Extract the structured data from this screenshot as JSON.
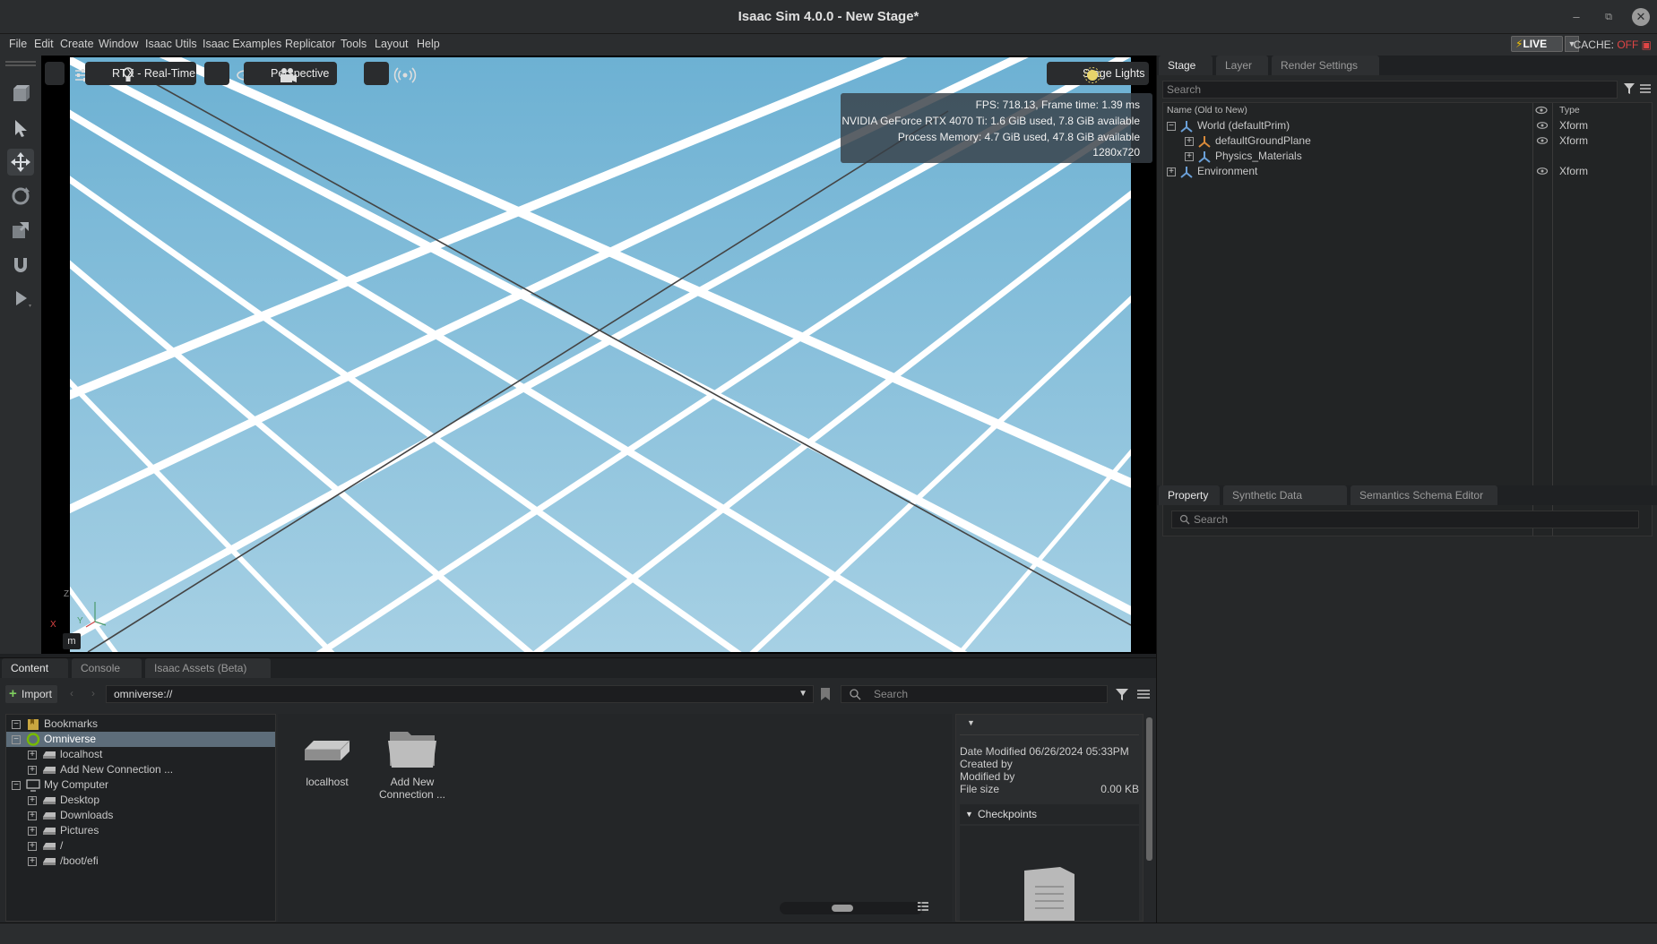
{
  "window": {
    "title": "Isaac Sim 4.0.0 - New Stage*",
    "minimize": "–",
    "restore": "⧉",
    "close": "✕"
  },
  "menu": {
    "items": [
      "File",
      "Edit",
      "Create",
      "Window",
      "Isaac Utils",
      "Isaac Examples",
      "Replicator",
      "Tools",
      "Layout",
      "Help"
    ],
    "live_label": "LIVE",
    "cache_label": "CACHE:",
    "cache_state": "OFF"
  },
  "viewport": {
    "renderer_label": "RTX - Real-Time",
    "camera_label": "Perspective",
    "lights_label": "Stage Lights",
    "stats": [
      "FPS: 718.13, Frame time: 1.39 ms",
      "NVIDIA GeForce RTX 4070 Ti: 1.6 GiB used, 7.8 GiB available",
      "Process Memory: 4.7 GiB used, 47.8 GiB available",
      "1280x720"
    ],
    "axis": {
      "x": "X",
      "y": "Y",
      "z": "Z"
    },
    "unit": "m",
    "colors": {
      "floor": "#7fbcd8",
      "line": "#ffffff"
    }
  },
  "stage": {
    "tabs": [
      "Stage",
      "Layer",
      "Render Settings"
    ],
    "search_placeholder": "Search",
    "columns": {
      "name": "Name (Old to New)",
      "type": "Type"
    },
    "rows": [
      {
        "name": "World (defaultPrim)",
        "type": "Xform",
        "expander": "−",
        "visible": true
      },
      {
        "name": "defaultGroundPlane",
        "type": "Xform",
        "expander": "+",
        "visible": true
      },
      {
        "name": "Physics_Materials",
        "type": "",
        "expander": "+",
        "visible": false
      },
      {
        "name": "Environment",
        "type": "Xform",
        "expander": "+",
        "visible": true
      }
    ]
  },
  "property": {
    "tabs": [
      "Property",
      "Synthetic Data Recorder",
      "Semantics Schema Editor"
    ],
    "search_placeholder": "Search"
  },
  "content": {
    "tabs": [
      "Content",
      "Console",
      "Isaac Assets (Beta)"
    ],
    "import_label": "Import",
    "path": "omniverse://",
    "search_placeholder": "Search",
    "tree": [
      {
        "label": "Bookmarks",
        "level": 0,
        "expander": "−"
      },
      {
        "label": "Omniverse",
        "level": 0,
        "expander": "−",
        "selected": true
      },
      {
        "label": "localhost",
        "level": 1,
        "expander": "+"
      },
      {
        "label": "Add New Connection ...",
        "level": 1,
        "expander": "+"
      },
      {
        "label": "My Computer",
        "level": 0,
        "expander": "−"
      },
      {
        "label": "Desktop",
        "level": 1,
        "expander": "+"
      },
      {
        "label": "Downloads",
        "level": 1,
        "expander": "+"
      },
      {
        "label": "Pictures",
        "level": 1,
        "expander": "+"
      },
      {
        "label": "/",
        "level": 1,
        "expander": "+"
      },
      {
        "label": "/boot/efi",
        "level": 1,
        "expander": "+"
      }
    ],
    "files": [
      {
        "label1": "localhost",
        "label2": ""
      },
      {
        "label1": "Add New",
        "label2": "Connection ..."
      }
    ],
    "info": {
      "date_modified": "Date Modified 06/26/2024 05:33PM",
      "created_by": "Created by",
      "modified_by": "Modified by",
      "file_size_label": "File size",
      "file_size_value": "0.00 KB",
      "checkpoints": "Checkpoints"
    }
  }
}
